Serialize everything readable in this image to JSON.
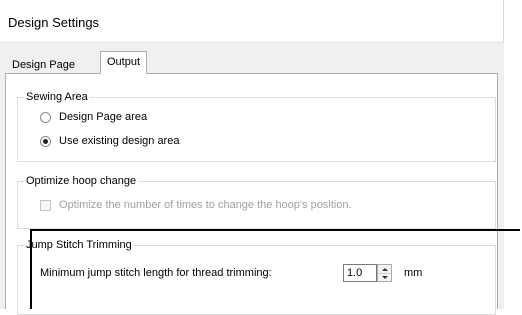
{
  "window": {
    "title": "Design Settings"
  },
  "tabs": [
    {
      "label": "Design Page",
      "active": false
    },
    {
      "label": "Output",
      "active": true
    }
  ],
  "sewing_area": {
    "caption": "Sewing Area",
    "options": [
      {
        "label": "Design Page area",
        "selected": false
      },
      {
        "label": "Use existing design area",
        "selected": true
      }
    ]
  },
  "optimize_hoop": {
    "caption": "Optimize hoop change",
    "checkbox_label": "Optimize the number of times to change the hoop's position.",
    "checked": false,
    "enabled": false
  },
  "jump_stitch": {
    "caption": "Jump Stitch Trimming",
    "min_length_label": "Minimum jump stitch length for thread trimming:",
    "min_length_value": "1.0",
    "unit": "mm"
  }
}
